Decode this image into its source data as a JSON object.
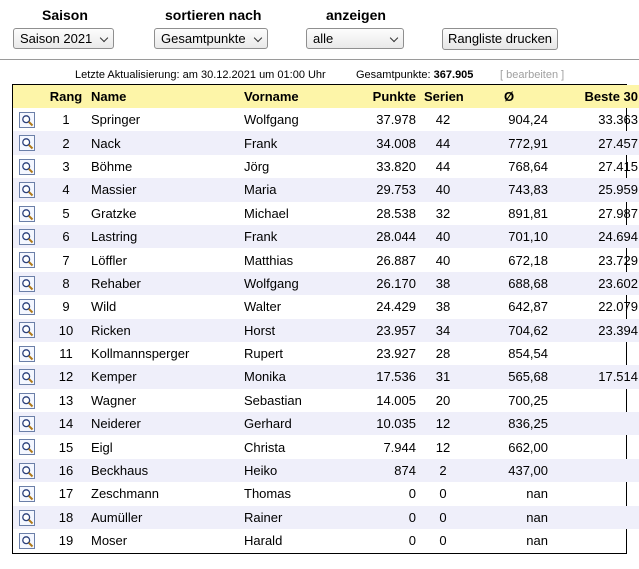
{
  "controls": {
    "season_label": "Saison",
    "season_value": "Saison 2021",
    "sort_label": "sortieren nach",
    "sort_value": "Gesamtpunkte",
    "show_label": "anzeigen",
    "show_value": "alle",
    "print_button": "Rangliste drucken"
  },
  "info": {
    "last_update": "Letzte Aktualisierung: am 30.12.2021 um 01:00 Uhr",
    "total_label": "Gesamtpunkte:",
    "total_value": "367.905",
    "edit_link": "[ bearbeiten ]"
  },
  "table": {
    "headers": {
      "rang": "Rang",
      "name": "Name",
      "vorname": "Vorname",
      "punkte": "Punkte",
      "serien": "Serien",
      "avg": "Ø",
      "best": "Beste 30"
    },
    "rows": [
      {
        "rang": "1",
        "name": "Springer",
        "vorname": "Wolfgang",
        "punkte": "37.978",
        "serien": "42",
        "avg": "904,24",
        "best": "33.363"
      },
      {
        "rang": "2",
        "name": "Nack",
        "vorname": "Frank",
        "punkte": "34.008",
        "serien": "44",
        "avg": "772,91",
        "best": "27.457"
      },
      {
        "rang": "3",
        "name": "Böhme",
        "vorname": "Jörg",
        "punkte": "33.820",
        "serien": "44",
        "avg": "768,64",
        "best": "27.415"
      },
      {
        "rang": "4",
        "name": "Massier",
        "vorname": "Maria",
        "punkte": "29.753",
        "serien": "40",
        "avg": "743,83",
        "best": "25.959"
      },
      {
        "rang": "5",
        "name": "Gratzke",
        "vorname": "Michael",
        "punkte": "28.538",
        "serien": "32",
        "avg": "891,81",
        "best": "27.987"
      },
      {
        "rang": "6",
        "name": "Lastring",
        "vorname": "Frank",
        "punkte": "28.044",
        "serien": "40",
        "avg": "701,10",
        "best": "24.694"
      },
      {
        "rang": "7",
        "name": "Löffler",
        "vorname": "Matthias",
        "punkte": "26.887",
        "serien": "40",
        "avg": "672,18",
        "best": "23.729"
      },
      {
        "rang": "8",
        "name": "Rehaber",
        "vorname": "Wolfgang",
        "punkte": "26.170",
        "serien": "38",
        "avg": "688,68",
        "best": "23.602"
      },
      {
        "rang": "9",
        "name": "Wild",
        "vorname": "Walter",
        "punkte": "24.429",
        "serien": "38",
        "avg": "642,87",
        "best": "22.079"
      },
      {
        "rang": "10",
        "name": "Ricken",
        "vorname": "Horst",
        "punkte": "23.957",
        "serien": "34",
        "avg": "704,62",
        "best": "23.394"
      },
      {
        "rang": "11",
        "name": "Kollmannsperger",
        "vorname": "Rupert",
        "punkte": "23.927",
        "serien": "28",
        "avg": "854,54",
        "best": ""
      },
      {
        "rang": "12",
        "name": "Kemper",
        "vorname": "Monika",
        "punkte": "17.536",
        "serien": "31",
        "avg": "565,68",
        "best": "17.514"
      },
      {
        "rang": "13",
        "name": "Wagner",
        "vorname": "Sebastian",
        "punkte": "14.005",
        "serien": "20",
        "avg": "700,25",
        "best": ""
      },
      {
        "rang": "14",
        "name": "Neiderer",
        "vorname": "Gerhard",
        "punkte": "10.035",
        "serien": "12",
        "avg": "836,25",
        "best": ""
      },
      {
        "rang": "15",
        "name": "Eigl",
        "vorname": "Christa",
        "punkte": "7.944",
        "serien": "12",
        "avg": "662,00",
        "best": ""
      },
      {
        "rang": "16",
        "name": "Beckhaus",
        "vorname": "Heiko",
        "punkte": "874",
        "serien": "2",
        "avg": "437,00",
        "best": ""
      },
      {
        "rang": "17",
        "name": "Zeschmann",
        "vorname": "Thomas",
        "punkte": "0",
        "serien": "0",
        "avg": "nan",
        "best": ""
      },
      {
        "rang": "18",
        "name": "Aumüller",
        "vorname": "Rainer",
        "punkte": "0",
        "serien": "0",
        "avg": "nan",
        "best": ""
      },
      {
        "rang": "19",
        "name": "Moser",
        "vorname": "Harald",
        "punkte": "0",
        "serien": "0",
        "avg": "nan",
        "best": ""
      }
    ]
  },
  "colors": {
    "header_bg": "#fdf5a8",
    "alt_row_bg": "#efeffa",
    "edit_link": "#a0a0a0"
  },
  "icons": {
    "row_detail": "magnifier-icon"
  }
}
